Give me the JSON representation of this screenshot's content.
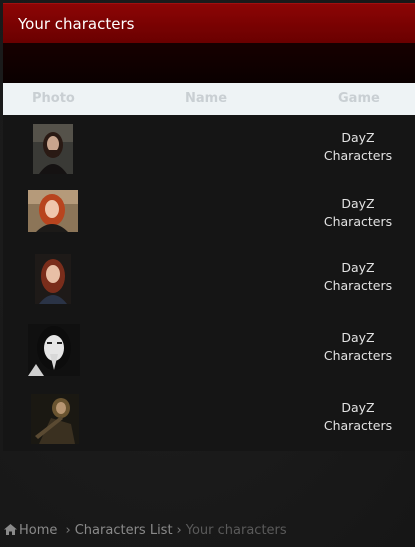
{
  "header": {
    "title": "Your characters"
  },
  "table": {
    "columns": {
      "photo": "Photo",
      "name": "Name",
      "game": "Game"
    },
    "rows": [
      {
        "name": "",
        "game_line1": "DayZ",
        "game_line2": "Characters"
      },
      {
        "name": "",
        "game_line1": "DayZ",
        "game_line2": "Characters"
      },
      {
        "name": "",
        "game_line1": "DayZ",
        "game_line2": "Characters"
      },
      {
        "name": "",
        "game_line1": "DayZ",
        "game_line2": "Characters"
      },
      {
        "name": "",
        "game_line1": "DayZ",
        "game_line2": "Characters"
      }
    ]
  },
  "breadcrumb": {
    "home": "Home",
    "list": "Characters List",
    "current": "Your characters",
    "separator": "›"
  },
  "colors": {
    "header_bg": "#7a0000",
    "table_head_bg": "#eef3f5",
    "page_bg": "#181818"
  }
}
